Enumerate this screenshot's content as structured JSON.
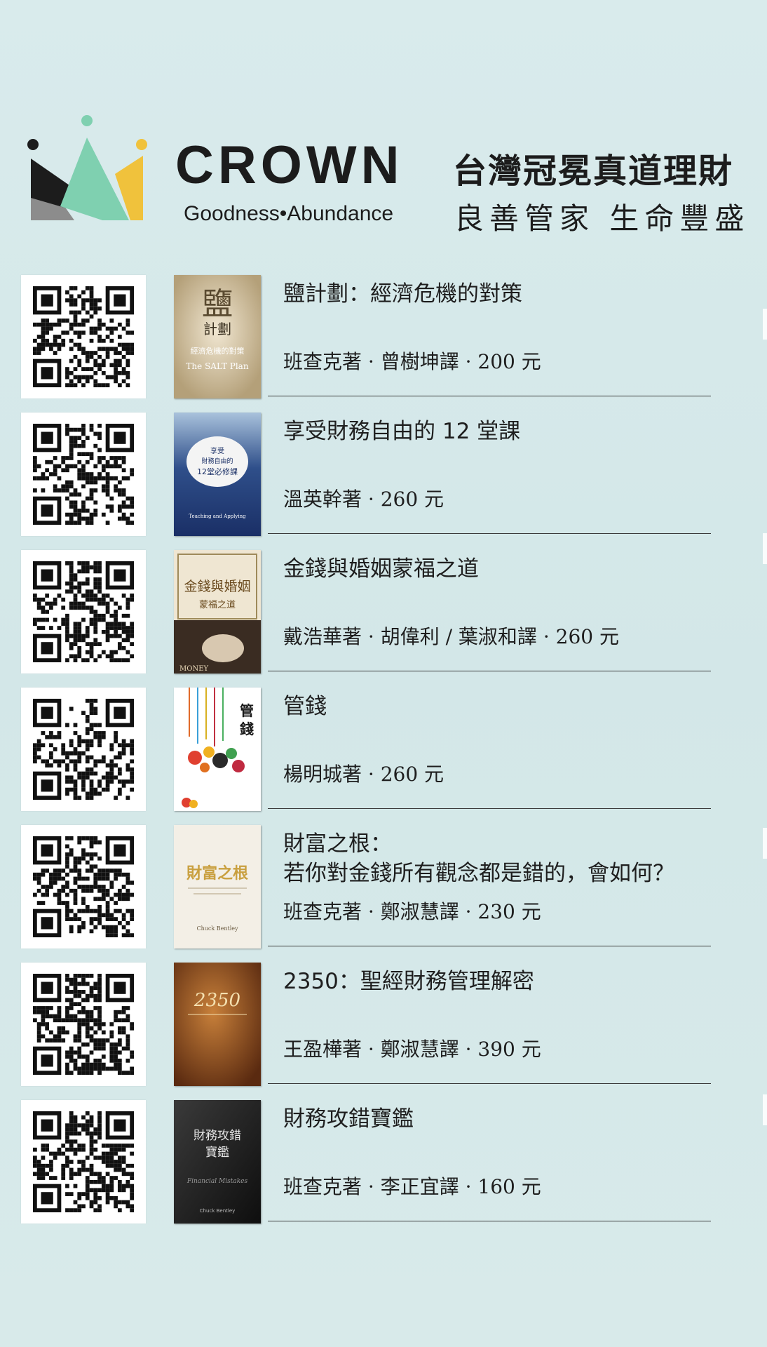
{
  "header": {
    "brand_name": "CROWN",
    "brand_tagline": "Goodness•Abundance",
    "org_name": "台灣冠冕真道理財",
    "org_slogan": "良善管家 生命豐盛",
    "logo_icon": "crown-logo-icon",
    "colors": {
      "mint": "#7fd0b0",
      "yellow": "#f0c23c",
      "gray": "#8c8c8c",
      "dark": "#1c1c1c"
    }
  },
  "books": [
    {
      "title_lines": [
        "鹽計劃：經濟危機的對策"
      ],
      "meta": "班查克著 · 曾樹坤譯 · 200 元",
      "cover": {
        "text": "鹽",
        "subtext": "計劃",
        "line3": "經濟危機的對策",
        "line4": "The SALT Plan"
      }
    },
    {
      "title_lines": [
        "享受財務自由的 12 堂課"
      ],
      "meta": "溫英幹著 · 260 元",
      "cover": {
        "text": "享受",
        "subtext": "財務自由的",
        "line3": "12堂必修課",
        "line4": "Teaching and Applying"
      }
    },
    {
      "title_lines": [
        "金錢與婚姻蒙福之道"
      ],
      "meta": "戴浩華著 · 胡偉利 / 葉淑和譯 · 260 元",
      "cover": {
        "text": "金錢與婚姻",
        "subtext": "蒙福之道",
        "line3": "MONEY",
        "line4": ""
      }
    },
    {
      "title_lines": [
        "管錢"
      ],
      "meta": "楊明城著 · 260 元",
      "cover": {
        "text": "管",
        "subtext": "錢",
        "line3": "",
        "line4": ""
      }
    },
    {
      "title_lines": [
        "財富之根：",
        "若你對金錢所有觀念都是錯的，會如何？"
      ],
      "meta": "班查克著 · 鄭淑慧譯 · 230 元",
      "cover": {
        "text": "財富之根",
        "subtext": "Chuck Bentley",
        "line3": "",
        "line4": ""
      }
    },
    {
      "title_lines": [
        "2350：聖經財務管理解密"
      ],
      "meta": "王盈樺著 · 鄭淑慧譯 · 390 元",
      "cover": {
        "text": "2350",
        "subtext": "",
        "line3": "",
        "line4": ""
      }
    },
    {
      "title_lines": [
        "財務攻錯寶鑑"
      ],
      "meta": "班查克著 · 李正宜譯 · 160 元",
      "cover": {
        "text": "財務攻錯",
        "subtext": "寶鑑",
        "line3": "Financial Mistakes",
        "line4": "Chuck Bentley"
      }
    }
  ]
}
